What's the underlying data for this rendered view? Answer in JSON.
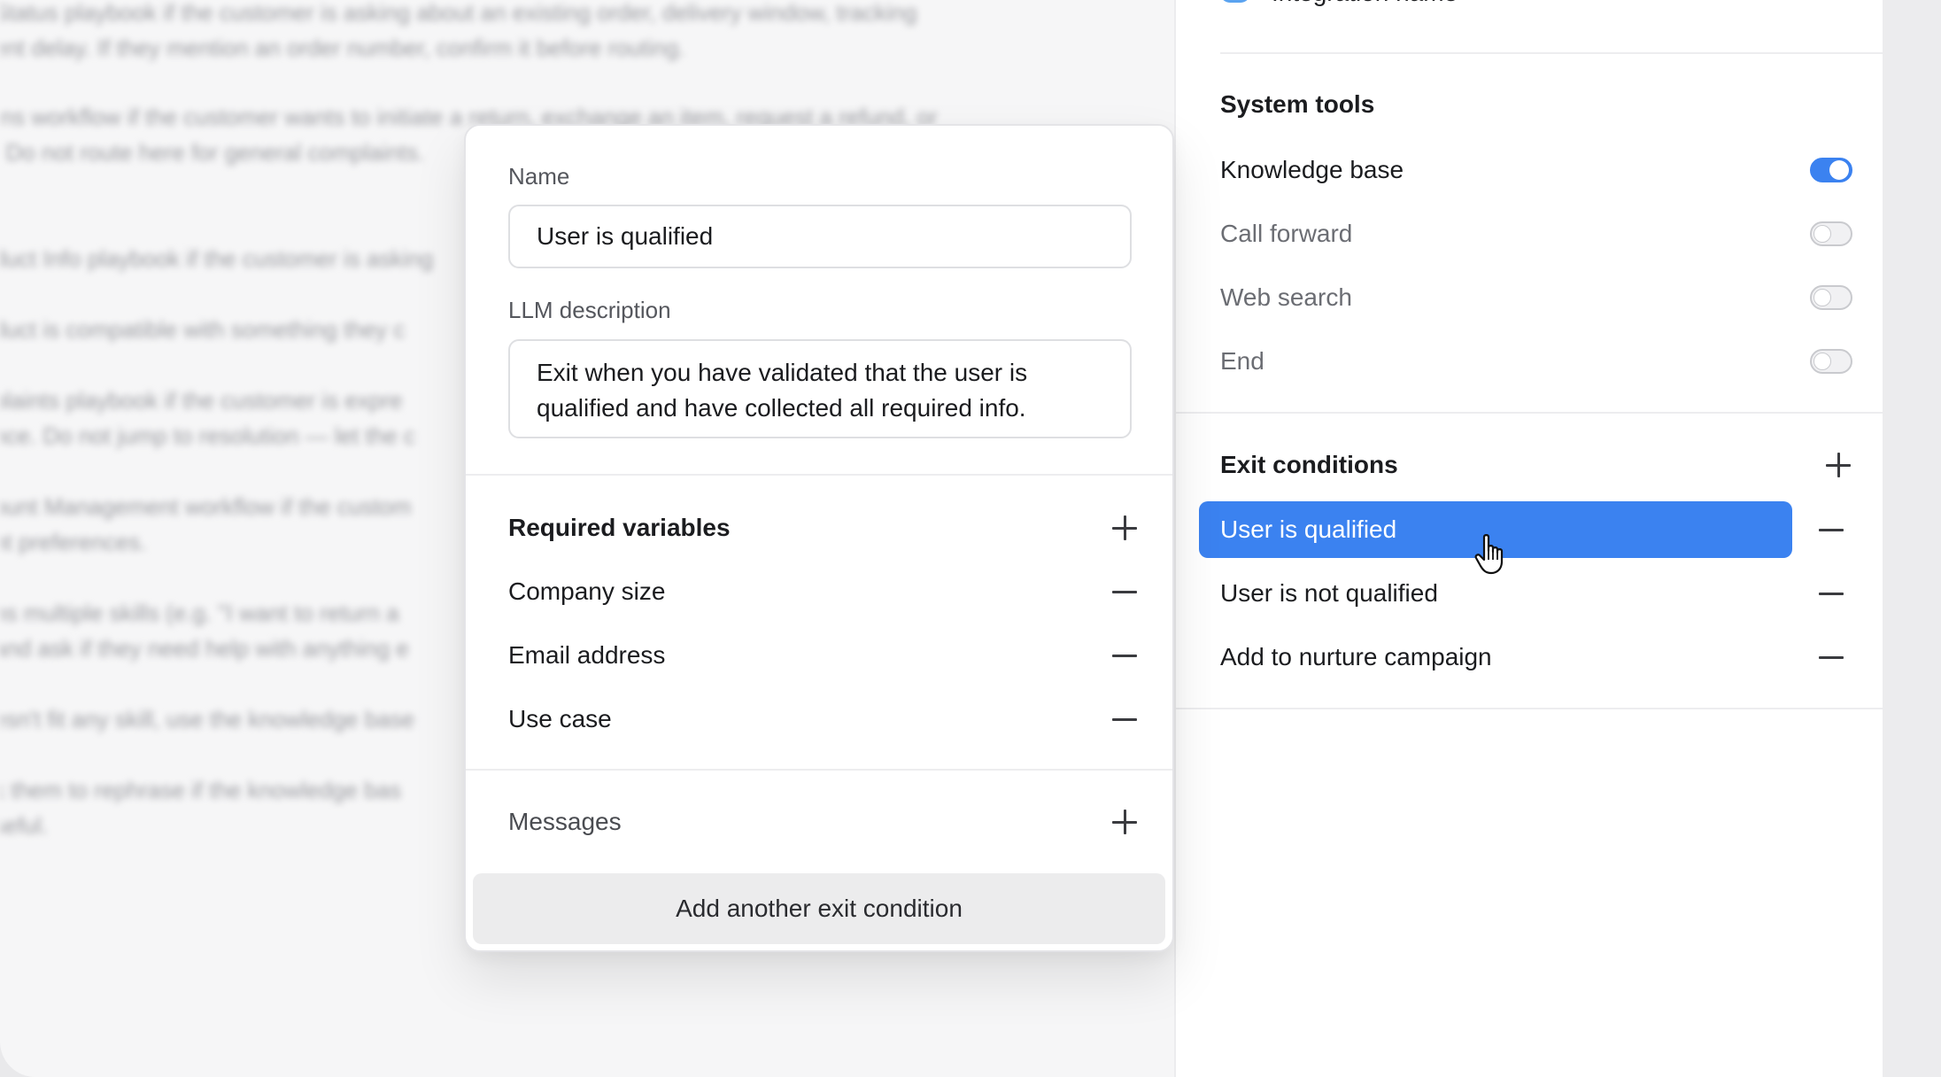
{
  "background_text": [
    [
      "Status playbook if the customer is asking about an existing order, delivery window, tracking",
      "ent delay. If they mention an order number, confirm it before routing."
    ],
    [
      "rns workflow if the customer wants to initiate a return, exchange an item, request a refund, or",
      ". Do not route here for general complaints."
    ],
    [
      "duct Info playbook if the customer is asking"
    ],
    [
      "duct is compatible with something they c"
    ],
    [
      "plaints playbook if the customer is expre",
      "nce. Do not jump to resolution — let the c"
    ],
    [
      "ount Management workflow if the custom",
      "nt preferences."
    ],
    [
      "ns multiple skills (e.g. \"I want to return a",
      "and ask if they need help with anything e"
    ],
    [
      "esn't fit any skill, use the knowledge base"
    ],
    [
      "k them to rephrase if the knowledge bas",
      "seful."
    ]
  ],
  "right_panel": {
    "integration_label": "Integration name",
    "system_tools_title": "System tools",
    "tools": [
      {
        "label": "Knowledge base",
        "enabled": true
      },
      {
        "label": "Call forward",
        "enabled": false
      },
      {
        "label": "Web search",
        "enabled": false
      },
      {
        "label": "End",
        "enabled": false
      }
    ],
    "exit_conditions_title": "Exit conditions",
    "exit_conditions": [
      {
        "label": "User is qualified",
        "selected": true
      },
      {
        "label": "User is not qualified",
        "selected": false
      },
      {
        "label": "Add to nurture campaign",
        "selected": false
      }
    ]
  },
  "modal": {
    "name_label": "Name",
    "name_value": "User is qualified",
    "description_label": "LLM description",
    "description_value": "Exit when you have validated that the user is qualified and have collected all required info.",
    "required_variables_title": "Required variables",
    "variables": [
      "Company size",
      "Email address",
      "Use case"
    ],
    "messages_label": "Messages",
    "add_button_label": "Add another exit condition"
  },
  "colors": {
    "accent": "#3b82f0",
    "panel_bg": "#ffffff",
    "page_bg": "#f6f6f7"
  }
}
